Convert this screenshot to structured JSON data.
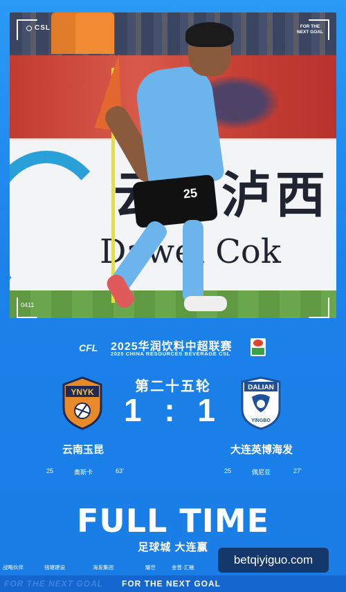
{
  "photo": {
    "csl_tag": "CSL",
    "brand_tag": "FOR THE NEXT GOAL",
    "photo_code": "0411",
    "ad_board_cn": "云南泸西",
    "ad_board_en": "Dawei Cok",
    "player_number": "25"
  },
  "league": {
    "logo_text": "CFL",
    "title_cn": "2025华润饮料中超联赛",
    "title_en": "2025 CHINA RESOURCES BEVERAGE CSL"
  },
  "match": {
    "round": "第二十五轮",
    "score": "1 : 1",
    "home": {
      "name": "云南玉昆",
      "badge_text": "YNYK",
      "scorer_number": "25",
      "scorer_name": "奥斯卡",
      "scorer_minute": "63'"
    },
    "away": {
      "name": "大连英博海发",
      "badge_text_top": "DALIAN",
      "badge_text_bottom": "YINGBO",
      "scorer_number": "25",
      "scorer_name": "佩尼亚",
      "scorer_minute": "27'"
    }
  },
  "result": {
    "headline": "FULL TIME",
    "subtitle": "足球城 大连赢"
  },
  "sponsors": {
    "label": "战略伙伴",
    "items": [
      "钱塘建设",
      "海发集团",
      "耀世",
      "金普·汇融"
    ]
  },
  "watermark": "betqiyiguo.com",
  "footer": {
    "ghost_text": "FOR THE NEXT GOAL",
    "main_text": "FOR THE NEXT GOAL"
  },
  "colors": {
    "background": "#1f8bf0",
    "footer": "#1565cf",
    "home_badge": "#e88a2a",
    "away_badge": "#1e4f9a"
  }
}
